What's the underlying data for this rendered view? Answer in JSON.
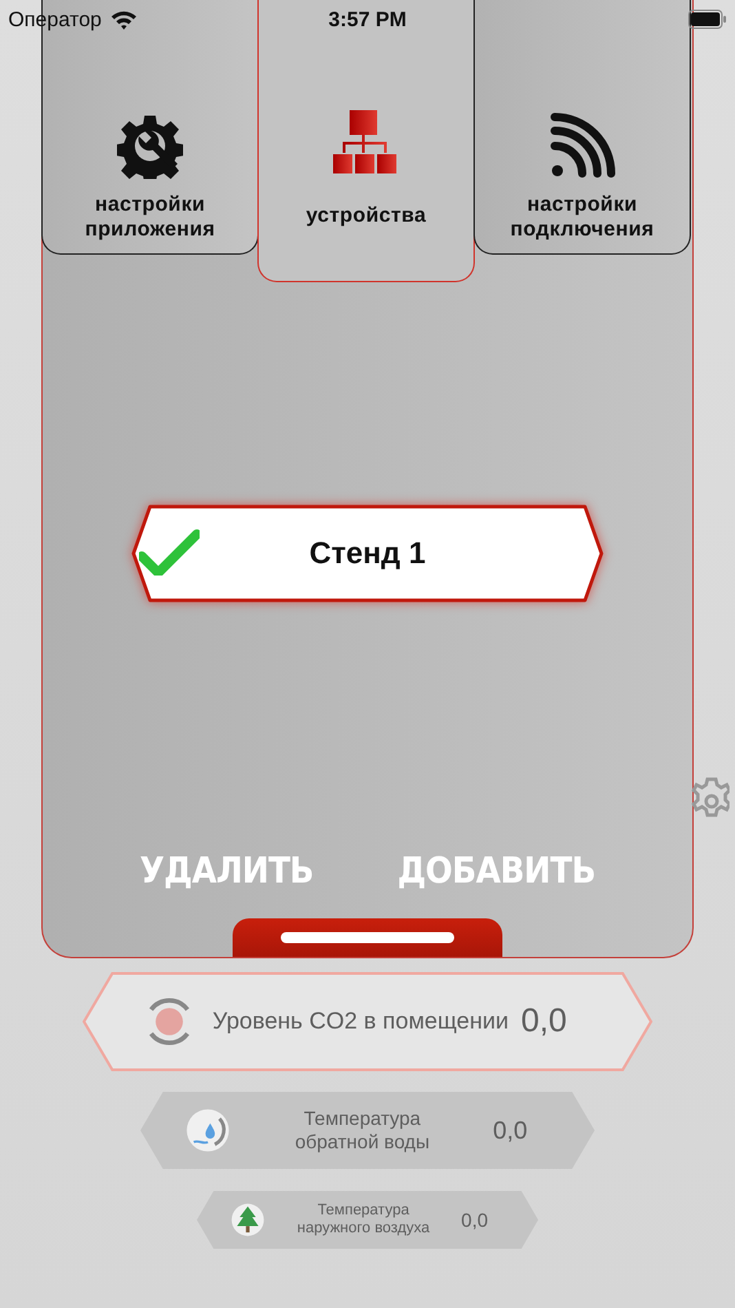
{
  "status_bar": {
    "carrier": "Оператор",
    "time": "3:57 PM"
  },
  "tabs": [
    {
      "label": "настройки приложения",
      "kind": "settings",
      "selected": false
    },
    {
      "label": "устройства",
      "kind": "network",
      "selected": true
    },
    {
      "label": "настройки подключения",
      "kind": "signal",
      "selected": false
    }
  ],
  "devices": [
    {
      "name": "Стенд 1",
      "checked": true
    }
  ],
  "actions": [
    "УДАЛИТЬ",
    "ДОБАВИТЬ"
  ],
  "sensors": [
    {
      "label": "Уровень CO2 в помещении",
      "value": "0,0",
      "kind": "co2"
    },
    {
      "label": "Температура обратной воды",
      "value": "0,0",
      "kind": "water"
    },
    {
      "label": "Температура наружного воздуха",
      "value": "0,0",
      "kind": "air"
    }
  ]
}
